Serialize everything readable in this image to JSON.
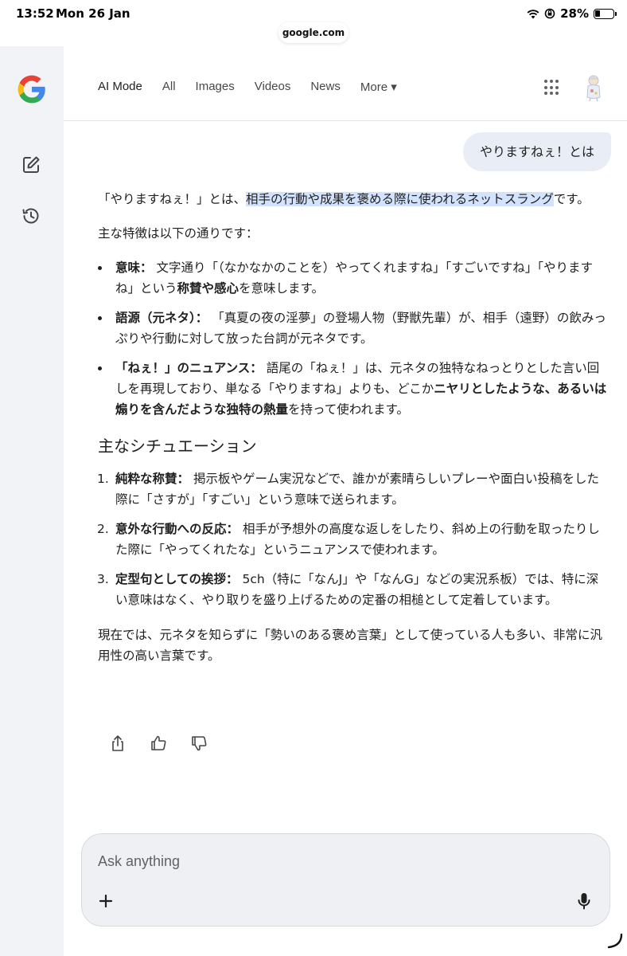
{
  "status_bar": {
    "time": "13:52",
    "date": "Mon 26 Jan",
    "battery": "28%"
  },
  "browser": {
    "url": "google.com"
  },
  "nav": {
    "tabs": [
      {
        "label": "AI Mode",
        "active": true
      },
      {
        "label": "All"
      },
      {
        "label": "Images"
      },
      {
        "label": "Videos"
      },
      {
        "label": "News"
      },
      {
        "label": "More ▾"
      }
    ]
  },
  "conversation": {
    "query": "やりますねぇ！とは",
    "intro_prefix": "「やりますねぇ！」とは、",
    "intro_highlight": "相手の行動や成果を褒める際に使われるネットスラング",
    "intro_suffix": "です。",
    "features_lead": "主な特徴は以下の通りです：",
    "bullets": [
      {
        "label": "意味：",
        "parts": [
          {
            "text": " 文字通り「（なかなかのことを）やってくれますね」「すごいですね」「やりますね」という",
            "bold": false
          },
          {
            "text": "称賛や感心",
            "bold": true
          },
          {
            "text": "を意味します。",
            "bold": false
          }
        ]
      },
      {
        "label": "語源（元ネタ）：",
        "parts": [
          {
            "text": " 「真夏の夜の淫夢」の登場人物（野獣先輩）が、相手（遠野）の飲みっぷりや行動に対して放った台詞が元ネタです。",
            "bold": false
          }
        ]
      },
      {
        "label": "「ねぇ！」のニュアンス：",
        "parts": [
          {
            "text": " 語尾の「ねぇ！」は、元ネタの独特なねっとりとした言い回しを再現しており、単なる「やりますね」よりも、どこか",
            "bold": false
          },
          {
            "text": "ニヤリとしたような、あるいは煽りを含んだような独特の熱量",
            "bold": true
          },
          {
            "text": "を持って使われます。",
            "bold": false
          }
        ]
      }
    ],
    "situations_heading": "主なシチュエーション",
    "numbered": [
      {
        "num": "1.",
        "label": "純粋な称賛：",
        "text": " 掲示板やゲーム実況などで、誰かが素晴らしいプレーや面白い投稿をした際に「さすが」「すごい」という意味で送られます。"
      },
      {
        "num": "2.",
        "label": "意外な行動への反応：",
        "text": " 相手が予想外の高度な返しをしたり、斜め上の行動を取ったりした際に「やってくれたな」というニュアンスで使われます。"
      },
      {
        "num": "3.",
        "label": "定型句としての挨拶：",
        "text": " 5ch（特に「なんJ」や「なんG」などの実況系板）では、特に深い意味はなく、やり取りを盛り上げるための定番の相槌として定着しています。"
      }
    ],
    "closing": "現在では、元ネタを知らずに「勢いのある褒め言葉」として使っている人も多い、非常に汎用性の高い言葉です。"
  },
  "ask_box": {
    "placeholder": "Ask anything"
  },
  "icons": {
    "rail": [
      "new-chat-icon",
      "history-icon"
    ],
    "feedback": [
      "share-icon",
      "thumbs-up-icon",
      "thumbs-down-icon"
    ],
    "brand_colors": {
      "blue": "#4285F4",
      "red": "#EA4335",
      "yellow": "#FBBC05",
      "green": "#34A853"
    }
  }
}
